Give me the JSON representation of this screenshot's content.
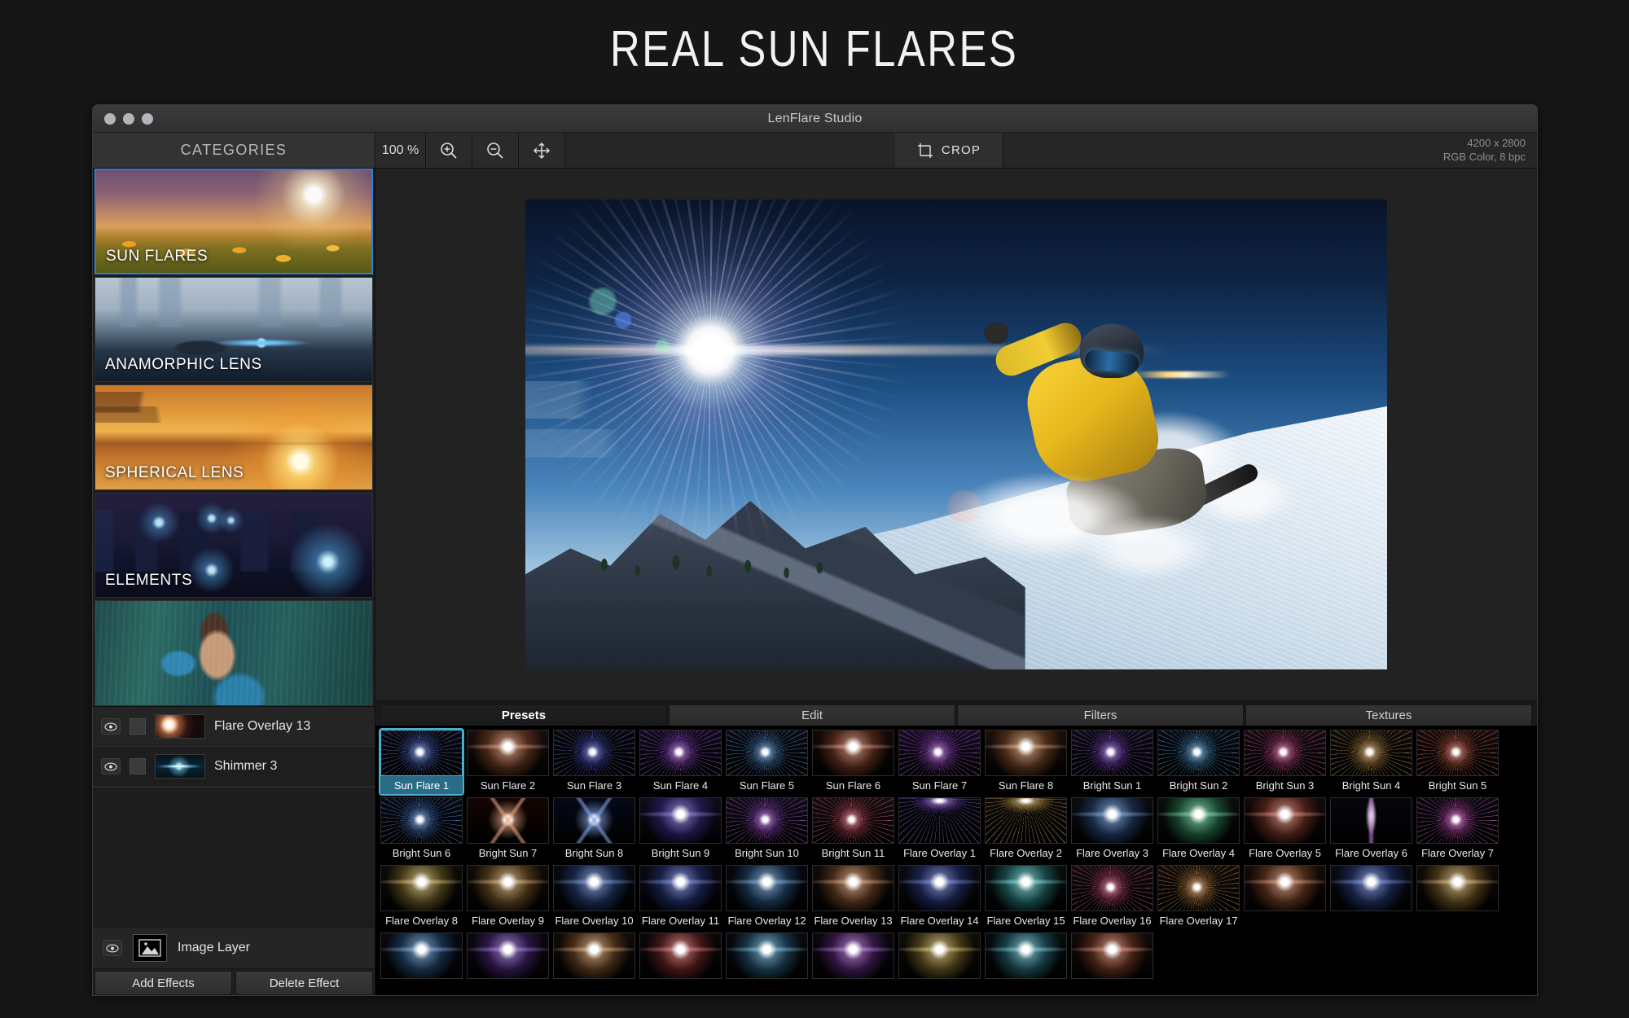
{
  "banner": {
    "title": "REAL SUN FLARES"
  },
  "window": {
    "title": "LenFlare Studio",
    "traffic_lights": [
      "close",
      "minimize",
      "zoom"
    ]
  },
  "toolbar": {
    "categories_label": "CATEGORIES",
    "zoom_level": "100 %",
    "zoom_in_icon": "zoom-in-icon",
    "zoom_out_icon": "zoom-out-icon",
    "move_icon": "move-icon",
    "crop_label": "CROP",
    "crop_icon": "crop-icon",
    "image_size": "4200 x 2800",
    "image_mode": "RGB Color, 8 bpc"
  },
  "categories": [
    {
      "label": "SUN FLARES",
      "art": "art-sunflares",
      "selected": true
    },
    {
      "label": "ANAMORPHIC LENS",
      "art": "art-anamorphic",
      "selected": false
    },
    {
      "label": "SPHERICAL LENS",
      "art": "art-spherical",
      "selected": false
    },
    {
      "label": "ELEMENTS",
      "art": "art-elements",
      "selected": false
    },
    {
      "label": "",
      "art": "art-portrait",
      "selected": false
    }
  ],
  "layers": {
    "effects": [
      {
        "name": "Flare Overlay 13",
        "thumb": "lt-flare13",
        "visible": true,
        "mask": true
      },
      {
        "name": "Shimmer 3",
        "thumb": "lt-shimmer3",
        "visible": true,
        "mask": true
      }
    ],
    "image_layer": {
      "name": "Image Layer",
      "visible": true,
      "icon": "image-icon"
    },
    "add_button": "Add Effects",
    "delete_button": "Delete Effect"
  },
  "panel": {
    "tabs": [
      {
        "label": "Presets",
        "active": true
      },
      {
        "label": "Edit",
        "active": false
      },
      {
        "label": "Filters",
        "active": false
      },
      {
        "label": "Textures",
        "active": false
      }
    ],
    "selected_preset": "Sun Flare 1",
    "presets": [
      {
        "label": "Sun Flare 1",
        "hue": 225,
        "style": "star",
        "bg": "#0a0a14"
      },
      {
        "label": "Sun Flare 2",
        "hue": 20,
        "style": "glow",
        "bg": "#1a0f0c"
      },
      {
        "label": "Sun Flare 3",
        "hue": 235,
        "style": "star",
        "bg": "#07080f"
      },
      {
        "label": "Sun Flare 4",
        "hue": 275,
        "style": "star",
        "bg": "#120a20"
      },
      {
        "label": "Sun Flare 5",
        "hue": 210,
        "style": "star",
        "bg": "#0a0c16"
      },
      {
        "label": "Sun Flare 6",
        "hue": 15,
        "style": "glow",
        "bg": "#120a08"
      },
      {
        "label": "Sun Flare 7",
        "hue": 280,
        "style": "star",
        "bg": "#1a0c28"
      },
      {
        "label": "Sun Flare 8",
        "hue": 25,
        "style": "glow",
        "bg": "#1c100c"
      },
      {
        "label": "Bright Sun 1",
        "hue": 265,
        "style": "star",
        "bg": "#0e0a18"
      },
      {
        "label": "Bright Sun 2",
        "hue": 205,
        "style": "star",
        "bg": "#060c14"
      },
      {
        "label": "Bright Sun 3",
        "hue": 330,
        "style": "star",
        "bg": "#180a12"
      },
      {
        "label": "Bright Sun 4",
        "hue": 35,
        "style": "star",
        "bg": "#100c06"
      },
      {
        "label": "Bright Sun 5",
        "hue": 10,
        "style": "star",
        "bg": "#1a0b0a"
      },
      {
        "label": "Bright Sun 6",
        "hue": 215,
        "style": "star",
        "bg": "#080c18"
      },
      {
        "label": "Bright Sun 7",
        "hue": 20,
        "style": "cross",
        "bg": "#140603"
      },
      {
        "label": "Bright Sun 8",
        "hue": 220,
        "style": "cross",
        "bg": "#060a18"
      },
      {
        "label": "Bright Sun 9",
        "hue": 250,
        "style": "glow",
        "bg": "#100c1c"
      },
      {
        "label": "Bright Sun 10",
        "hue": 280,
        "style": "star",
        "bg": "#130c1c"
      },
      {
        "label": "Bright Sun 11",
        "hue": 350,
        "style": "star",
        "bg": "#1a0c10"
      },
      {
        "label": "Flare Overlay 1",
        "hue": 265,
        "style": "top",
        "bg": "#06060e"
      },
      {
        "label": "Flare Overlay 2",
        "hue": 40,
        "style": "top",
        "bg": "#0e0a06"
      },
      {
        "label": "Flare Overlay 3",
        "hue": 215,
        "style": "glow",
        "bg": "#0a0c12"
      },
      {
        "label": "Flare Overlay 4",
        "hue": 150,
        "style": "glow",
        "bg": "#0a0f0c"
      },
      {
        "label": "Flare Overlay 5",
        "hue": 10,
        "style": "glow",
        "bg": "#140a0a"
      },
      {
        "label": "Flare Overlay 6",
        "hue": 285,
        "style": "beam",
        "bg": "#08060e"
      },
      {
        "label": "Flare Overlay 7",
        "hue": 310,
        "style": "star",
        "bg": "#0c0812"
      },
      {
        "label": "Flare Overlay 8",
        "hue": 45,
        "style": "glow",
        "bg": "#0c0c08"
      },
      {
        "label": "Flare Overlay 9",
        "hue": 35,
        "style": "glow",
        "bg": "#100c08"
      },
      {
        "label": "Flare Overlay 10",
        "hue": 220,
        "style": "glow",
        "bg": "#080a12"
      },
      {
        "label": "Flare Overlay 11",
        "hue": 230,
        "style": "glow",
        "bg": "#0a0a14"
      },
      {
        "label": "Flare Overlay 12",
        "hue": 210,
        "style": "glow",
        "bg": "#06080e"
      },
      {
        "label": "Flare Overlay 13",
        "hue": 25,
        "style": "glow",
        "bg": "#100c0a"
      },
      {
        "label": "Flare Overlay 14",
        "hue": 230,
        "style": "glow",
        "bg": "#0a0c14"
      },
      {
        "label": "Flare Overlay 15",
        "hue": 180,
        "style": "glow",
        "bg": "#07100f"
      },
      {
        "label": "Flare Overlay 16",
        "hue": 340,
        "style": "star",
        "bg": "#150a10"
      },
      {
        "label": "Flare Overlay 17",
        "hue": 30,
        "style": "star",
        "bg": "#140c06"
      },
      {
        "label": "",
        "hue": 20,
        "style": "glow",
        "bg": "#160c08"
      },
      {
        "label": "",
        "hue": 225,
        "style": "glow",
        "bg": "#0a0c16"
      },
      {
        "label": "",
        "hue": 40,
        "style": "glow",
        "bg": "#100c08"
      },
      {
        "label": "",
        "hue": 210,
        "style": "glow",
        "bg": "#080a12"
      },
      {
        "label": "",
        "hue": 265,
        "style": "glow",
        "bg": "#0c0812"
      },
      {
        "label": "",
        "hue": 30,
        "style": "glow",
        "bg": "#120c08"
      },
      {
        "label": "",
        "hue": 0,
        "style": "glow",
        "bg": "#0a0808"
      },
      {
        "label": "",
        "hue": 200,
        "style": "glow",
        "bg": "#070a10"
      },
      {
        "label": "",
        "hue": 280,
        "style": "glow",
        "bg": "#0b0810"
      },
      {
        "label": "",
        "hue": 45,
        "style": "glow",
        "bg": "#100e08"
      },
      {
        "label": "",
        "hue": 190,
        "style": "glow",
        "bg": "#060e10"
      },
      {
        "label": "",
        "hue": 15,
        "style": "glow",
        "bg": "#120a08"
      }
    ]
  }
}
